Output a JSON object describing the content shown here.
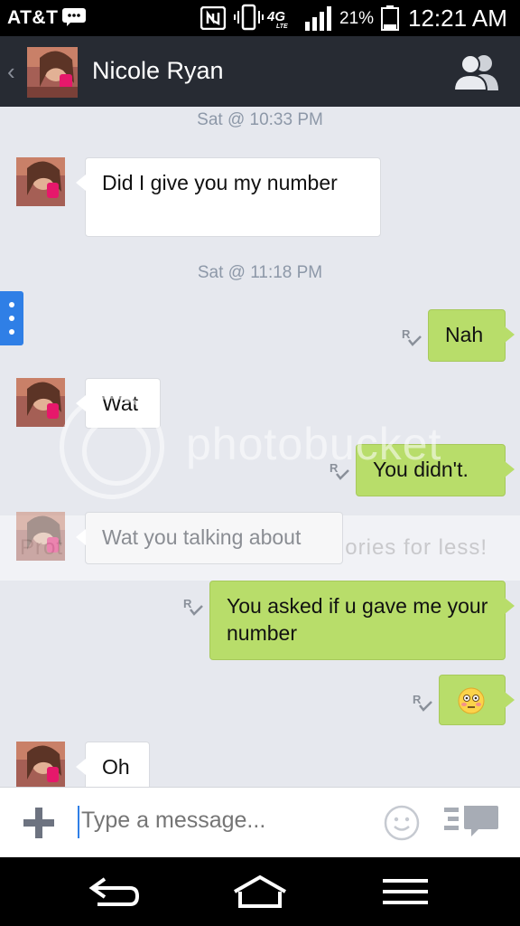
{
  "status_bar": {
    "carrier": "AT&T",
    "network": "4G",
    "network_sub": "LTE",
    "battery": "21%",
    "time": "12:21 AM"
  },
  "header": {
    "contact_name": "Nicole Ryan"
  },
  "messages": [
    {
      "type": "timestamp",
      "text": "Sat @ 10:33 PM"
    },
    {
      "type": "in",
      "text": "Did I give you my number"
    },
    {
      "type": "timestamp",
      "text": "Sat @ 11:18 PM"
    },
    {
      "type": "out",
      "text": "Nah",
      "read_marker": "R"
    },
    {
      "type": "in",
      "text": "Wat"
    },
    {
      "type": "out",
      "text": "You didn't.",
      "read_marker": "R"
    },
    {
      "type": "in",
      "text": "Wat you talking about"
    },
    {
      "type": "out",
      "text": "You asked if u gave me your number",
      "read_marker": "R"
    },
    {
      "type": "out",
      "emoji": "flushed-face",
      "read_marker": "R"
    },
    {
      "type": "in",
      "text": "Oh"
    }
  ],
  "watermark": {
    "word": "photobucket",
    "promo_left": "Prot",
    "promo_right": "ories for less!"
  },
  "input": {
    "placeholder": "Type a message..."
  },
  "colors": {
    "header_bg": "#272b33",
    "chat_bg": "#e6e8ee",
    "outgoing_bubble": "#b8dd6a",
    "incoming_bubble": "#ffffff",
    "accent": "#2f7fe6"
  }
}
